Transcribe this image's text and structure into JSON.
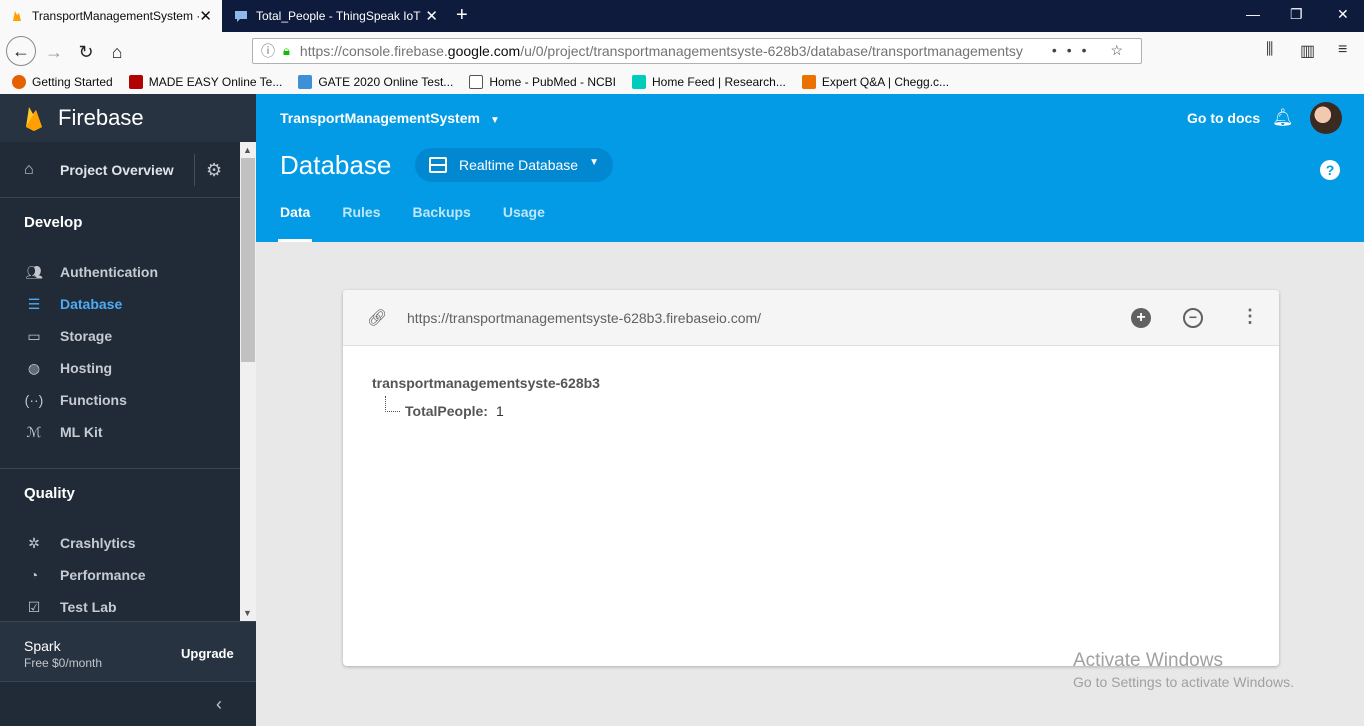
{
  "browser": {
    "tabs": [
      {
        "title": "TransportManagementSystem ·",
        "icon": "firebase-flame-icon"
      },
      {
        "title": "Total_People - ThingSpeak IoT",
        "icon": "chat-icon"
      }
    ],
    "url_prefix": "https://console.firebase.",
    "url_domain": "google.com",
    "url_suffix": "/u/0/project/transportmanagementsyste-628b3/database/transportmanagementsy",
    "bookmarks": [
      {
        "label": "Getting Started",
        "color": "#e66000"
      },
      {
        "label": "MADE EASY Online Te...",
        "color": "#b30000"
      },
      {
        "label": "GATE 2020 Online Test...",
        "color": "#3d8fd6"
      },
      {
        "label": "Home - PubMed - NCBI",
        "color": "#555555"
      },
      {
        "label": "Home Feed | Research...",
        "color": "#00ccbb"
      },
      {
        "label": "Expert Q&A | Chegg.c...",
        "color": "#eb7100"
      }
    ]
  },
  "sidebar": {
    "brand": "Firebase",
    "overview": "Project Overview",
    "develop_title": "Develop",
    "develop_items": [
      {
        "label": "Authentication",
        "icon": "people-icon"
      },
      {
        "label": "Database",
        "icon": "database-icon",
        "active": true
      },
      {
        "label": "Storage",
        "icon": "image-icon"
      },
      {
        "label": "Hosting",
        "icon": "globe-icon"
      },
      {
        "label": "Functions",
        "icon": "functions-icon"
      },
      {
        "label": "ML Kit",
        "icon": "mlkit-icon"
      }
    ],
    "quality_title": "Quality",
    "quality_items": [
      {
        "label": "Crashlytics",
        "icon": "crashlytics-icon"
      },
      {
        "label": "Performance",
        "icon": "speedometer-icon"
      },
      {
        "label": "Test Lab",
        "icon": "checkbox-icon"
      }
    ],
    "plan": "Spark",
    "price": "Free $0/month",
    "upgrade": "Upgrade"
  },
  "header": {
    "project": "TransportManagementSystem",
    "docs": "Go to docs",
    "title": "Database",
    "db_select": "Realtime Database",
    "tabs": [
      "Data",
      "Rules",
      "Backups",
      "Usage"
    ],
    "active_tab": "Data",
    "accent": "#039be5"
  },
  "database": {
    "url": "https://transportmanagementsyste-628b3.firebaseio.com/",
    "root": "transportmanagementsyste-628b3",
    "child_key": "TotalPeople:",
    "child_value": "1"
  },
  "watermark": {
    "line1": "Activate Windows",
    "line2": "Go to Settings to activate Windows."
  }
}
